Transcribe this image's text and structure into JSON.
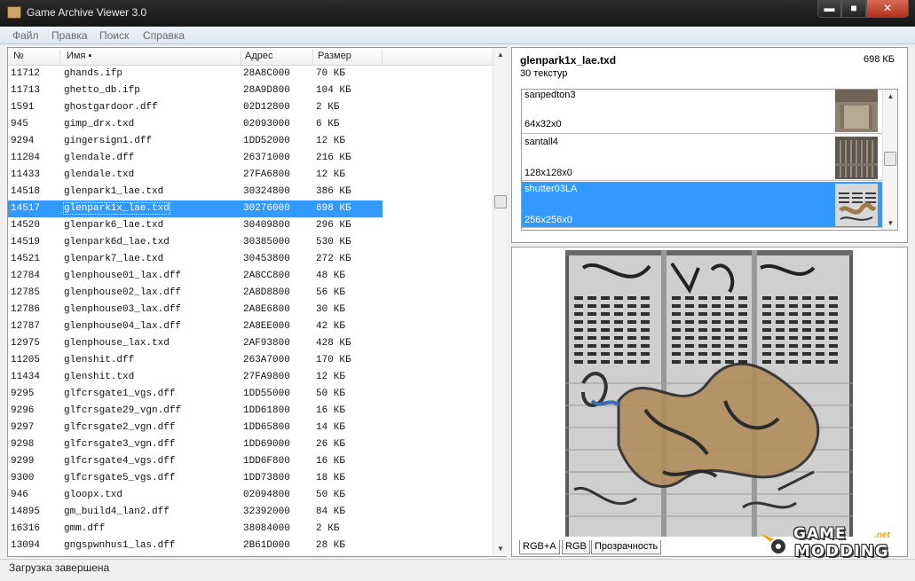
{
  "window": {
    "title": "Game Archive Viewer 3.0",
    "minimize": "▬",
    "maximize": "■",
    "close": "✕"
  },
  "menu": {
    "items": [
      "Файл",
      "Правка",
      "Поиск",
      "Справка"
    ]
  },
  "file_list": {
    "columns": {
      "num": "№",
      "name": "Имя ▪",
      "addr": "Адрес",
      "size": "Размер"
    },
    "rows": [
      {
        "num": "11712",
        "name": "ghands.ifp",
        "addr": "28A8C000",
        "size": "70 КБ"
      },
      {
        "num": "11713",
        "name": "ghetto_db.ifp",
        "addr": "28A9D800",
        "size": "104 КБ"
      },
      {
        "num": "1591",
        "name": "ghostgardoor.dff",
        "addr": "02D12800",
        "size": "2 КБ"
      },
      {
        "num": "945",
        "name": "gimp_drx.txd",
        "addr": "02093000",
        "size": "6 КБ"
      },
      {
        "num": "9294",
        "name": "gingersign1.dff",
        "addr": "1DD52000",
        "size": "12 КБ"
      },
      {
        "num": "11204",
        "name": "glendale.dff",
        "addr": "26371000",
        "size": "216 КБ"
      },
      {
        "num": "11433",
        "name": "glendale.txd",
        "addr": "27FA6800",
        "size": "12 КБ"
      },
      {
        "num": "14518",
        "name": "glenpark1_lae.txd",
        "addr": "30324800",
        "size": "386 КБ"
      },
      {
        "num": "14517",
        "name": "glenpark1x_lae.txd",
        "addr": "30276000",
        "size": "698 КБ",
        "selected": true
      },
      {
        "num": "14520",
        "name": "glenpark6_lae.txd",
        "addr": "30409800",
        "size": "296 КБ"
      },
      {
        "num": "14519",
        "name": "glenpark6d_lae.txd",
        "addr": "30385000",
        "size": "530 КБ"
      },
      {
        "num": "14521",
        "name": "glenpark7_lae.txd",
        "addr": "30453800",
        "size": "272 КБ"
      },
      {
        "num": "12784",
        "name": "glenphouse01_lax.dff",
        "addr": "2A8CC800",
        "size": "48 КБ"
      },
      {
        "num": "12785",
        "name": "glenphouse02_lax.dff",
        "addr": "2A8D8800",
        "size": "56 КБ"
      },
      {
        "num": "12786",
        "name": "glenphouse03_lax.dff",
        "addr": "2A8E6800",
        "size": "30 КБ"
      },
      {
        "num": "12787",
        "name": "glenphouse04_lax.dff",
        "addr": "2A8EE000",
        "size": "42 КБ"
      },
      {
        "num": "12975",
        "name": "glenphouse_lax.txd",
        "addr": "2AF93800",
        "size": "428 КБ"
      },
      {
        "num": "11205",
        "name": "glenshit.dff",
        "addr": "263A7000",
        "size": "170 КБ"
      },
      {
        "num": "11434",
        "name": "glenshit.txd",
        "addr": "27FA9800",
        "size": "12 КБ"
      },
      {
        "num": "9295",
        "name": "glfcrsgate1_vgs.dff",
        "addr": "1DD55000",
        "size": "50 КБ"
      },
      {
        "num": "9296",
        "name": "glfcrsgate29_vgn.dff",
        "addr": "1DD61800",
        "size": "16 КБ"
      },
      {
        "num": "9297",
        "name": "glfcrsgate2_vgn.dff",
        "addr": "1DD65800",
        "size": "14 КБ"
      },
      {
        "num": "9298",
        "name": "glfcrsgate3_vgn.dff",
        "addr": "1DD69000",
        "size": "26 КБ"
      },
      {
        "num": "9299",
        "name": "glfcrsgate4_vgs.dff",
        "addr": "1DD6F800",
        "size": "16 КБ"
      },
      {
        "num": "9300",
        "name": "glfcrsgate5_vgs.dff",
        "addr": "1DD73800",
        "size": "18 КБ"
      },
      {
        "num": "946",
        "name": "gloopx.txd",
        "addr": "02094800",
        "size": "50 КБ"
      },
      {
        "num": "14895",
        "name": "gm_build4_lan2.dff",
        "addr": "32392000",
        "size": "84 КБ"
      },
      {
        "num": "16316",
        "name": "gmm.dff",
        "addr": "38084000",
        "size": "2 КБ"
      },
      {
        "num": "13094",
        "name": "gngspwnhus1_las.dff",
        "addr": "2B61D000",
        "size": "28 КБ"
      }
    ]
  },
  "archive": {
    "name": "glenpark1x_lae.txd",
    "size": "698 КБ",
    "texture_count": "30 текстур",
    "textures": [
      {
        "name": "sanpedton3",
        "dims": "64x32x0"
      },
      {
        "name": "santall4",
        "dims": "128x128x0"
      },
      {
        "name": "shutter03LA",
        "dims": "256x256x0",
        "selected": true
      }
    ]
  },
  "preview": {
    "tabs": [
      "RGB+A",
      "RGB",
      "Прозрачность"
    ],
    "active_tab": "RGB+A"
  },
  "watermark": {
    "line1": "GAME",
    "line2": "MODDING",
    "suffix": ".net"
  },
  "status": {
    "text": "Загрузка завершена"
  }
}
